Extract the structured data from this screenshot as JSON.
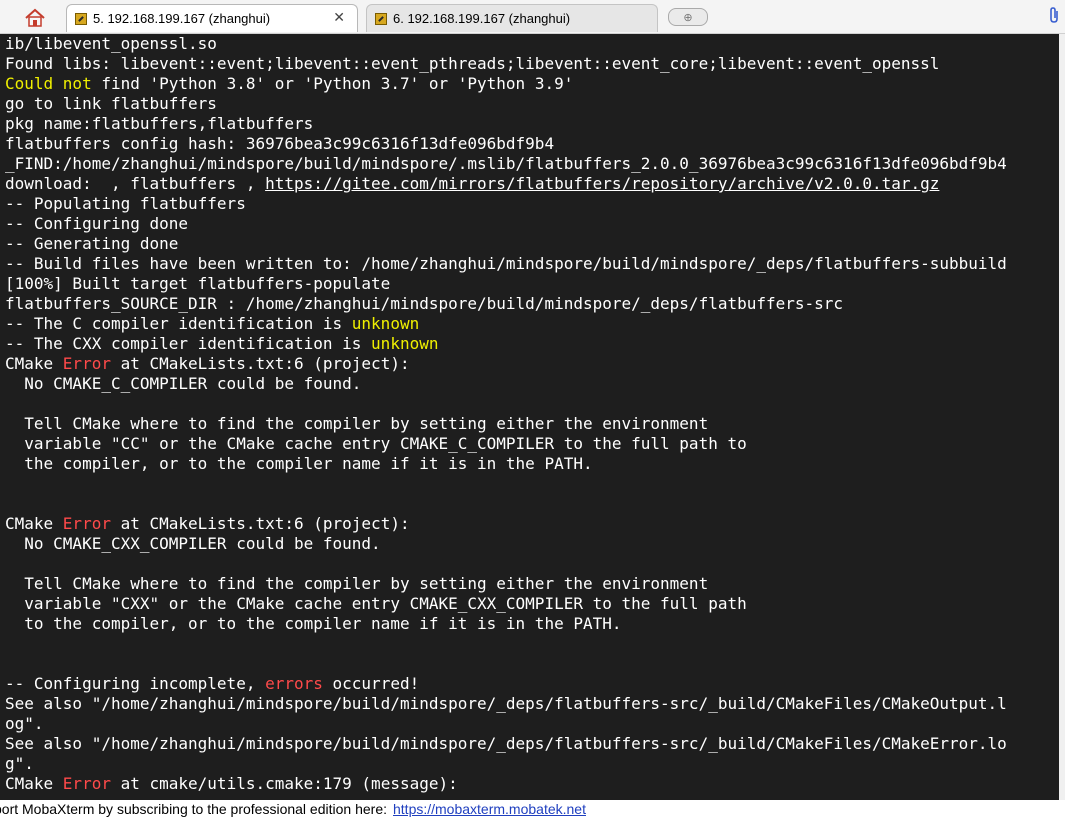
{
  "tabs": {
    "home_icon": "home-icon",
    "active_label": "5. 192.168.199.167 (zhanghui)",
    "inactive_label": "6. 192.168.199.167 (zhanghui)",
    "close_glyph": "✕",
    "new_tab_glyph": "⊕"
  },
  "terminal": {
    "lines": [
      [
        {
          "t": "ib/libevent_openssl.so"
        }
      ],
      [
        {
          "t": "Found libs: libevent::event;libevent::event_pthreads;libevent::event_core;libevent::event_openssl"
        }
      ],
      [
        {
          "t": "Could not",
          "c": "yellow"
        },
        {
          "t": " find 'Python 3.8' or 'Python 3.7' or 'Python 3.9'"
        }
      ],
      [
        {
          "t": "go to link flatbuffers"
        }
      ],
      [
        {
          "t": "pkg name:flatbuffers,flatbuffers"
        }
      ],
      [
        {
          "t": "flatbuffers config hash: 36976bea3c99c6316f13dfe096bdf9b4"
        }
      ],
      [
        {
          "t": "_FIND:/home/zhanghui/mindspore/build/mindspore/.mslib/flatbuffers_2.0.0_36976bea3c99c6316f13dfe096bdf9b4"
        }
      ],
      [
        {
          "t": "download:  , flatbuffers , "
        },
        {
          "t": "https://gitee.com/mirrors/flatbuffers/repository/archive/v2.0.0.tar.gz",
          "c": "link"
        }
      ],
      [
        {
          "t": "-- Populating flatbuffers"
        }
      ],
      [
        {
          "t": "-- Configuring done"
        }
      ],
      [
        {
          "t": "-- Generating done"
        }
      ],
      [
        {
          "t": "-- Build files have been written to: /home/zhanghui/mindspore/build/mindspore/_deps/flatbuffers-subbuild"
        }
      ],
      [
        {
          "t": "[100%] Built target flatbuffers-populate"
        }
      ],
      [
        {
          "t": "flatbuffers_SOURCE_DIR : /home/zhanghui/mindspore/build/mindspore/_deps/flatbuffers-src"
        }
      ],
      [
        {
          "t": "-- The C compiler identification is "
        },
        {
          "t": "unknown",
          "c": "yellow"
        }
      ],
      [
        {
          "t": "-- The CXX compiler identification is "
        },
        {
          "t": "unknown",
          "c": "yellow"
        }
      ],
      [
        {
          "t": "CMake "
        },
        {
          "t": "Error",
          "c": "red"
        },
        {
          "t": " at CMakeLists.txt:6 (project):"
        }
      ],
      [
        {
          "t": "  No CMAKE_C_COMPILER could be found."
        }
      ],
      [
        {
          "t": ""
        }
      ],
      [
        {
          "t": "  Tell CMake where to find the compiler by setting either the environment"
        }
      ],
      [
        {
          "t": "  variable \"CC\" or the CMake cache entry CMAKE_C_COMPILER to the full path to"
        }
      ],
      [
        {
          "t": "  the compiler, or to the compiler name if it is in the PATH."
        }
      ],
      [
        {
          "t": ""
        }
      ],
      [
        {
          "t": ""
        }
      ],
      [
        {
          "t": "CMake "
        },
        {
          "t": "Error",
          "c": "red"
        },
        {
          "t": " at CMakeLists.txt:6 (project):"
        }
      ],
      [
        {
          "t": "  No CMAKE_CXX_COMPILER could be found."
        }
      ],
      [
        {
          "t": ""
        }
      ],
      [
        {
          "t": "  Tell CMake where to find the compiler by setting either the environment"
        }
      ],
      [
        {
          "t": "  variable \"CXX\" or the CMake cache entry CMAKE_CXX_COMPILER to the full path"
        }
      ],
      [
        {
          "t": "  to the compiler, or to the compiler name if it is in the PATH."
        }
      ],
      [
        {
          "t": ""
        }
      ],
      [
        {
          "t": ""
        }
      ],
      [
        {
          "t": "-- Configuring incomplete, "
        },
        {
          "t": "errors",
          "c": "red"
        },
        {
          "t": " occurred!"
        }
      ],
      [
        {
          "t": "See also \"/home/zhanghui/mindspore/build/mindspore/_deps/flatbuffers-src/_build/CMakeFiles/CMakeOutput.l"
        }
      ],
      [
        {
          "t": "og\"."
        }
      ],
      [
        {
          "t": "See also \"/home/zhanghui/mindspore/build/mindspore/_deps/flatbuffers-src/_build/CMakeFiles/CMakeError.lo"
        }
      ],
      [
        {
          "t": "g\"."
        }
      ],
      [
        {
          "t": "CMake "
        },
        {
          "t": "Error",
          "c": "red"
        },
        {
          "t": " at cmake/utils.cmake:179 (message):"
        }
      ]
    ],
    "colors": {
      "background": "#1e1e1e",
      "text": "#ffffff",
      "yellow": "#f0f000",
      "red": "#ff4a4a"
    }
  },
  "statusbar": {
    "message": "port MobaXterm by subscribing to the professional edition here:",
    "link": "https://mobaxterm.mobatek.net"
  }
}
